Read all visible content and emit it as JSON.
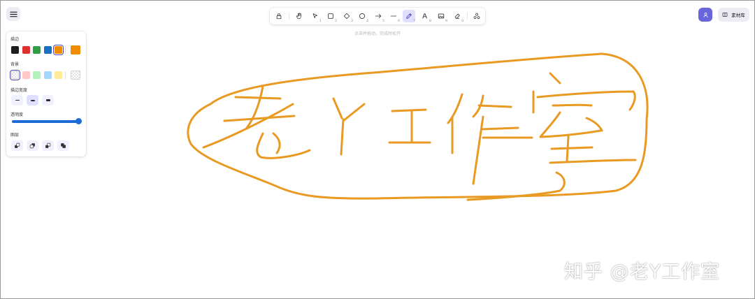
{
  "hint": "点击并拖动，完成时松开",
  "toolbar": {
    "tools": [
      {
        "name": "lock-tool",
        "icon": "lock-icon",
        "key": ""
      },
      {
        "name": "hand-tool",
        "icon": "hand-icon",
        "key": ""
      },
      {
        "name": "select-tool",
        "icon": "pointer-icon",
        "key": "1"
      },
      {
        "name": "rectangle-tool",
        "icon": "square-icon",
        "key": "2"
      },
      {
        "name": "diamond-tool",
        "icon": "diamond-icon",
        "key": "3"
      },
      {
        "name": "ellipse-tool",
        "icon": "circle-icon",
        "key": "4"
      },
      {
        "name": "arrow-tool",
        "icon": "arrow-right-icon",
        "key": "5"
      },
      {
        "name": "line-tool",
        "icon": "line-icon",
        "key": "6"
      },
      {
        "name": "draw-tool",
        "icon": "pencil-icon",
        "key": "7",
        "active": true
      },
      {
        "name": "text-tool",
        "icon": "text-icon",
        "key": "8"
      },
      {
        "name": "image-tool",
        "icon": "image-icon",
        "key": "9"
      },
      {
        "name": "eraser-tool",
        "icon": "eraser-icon",
        "key": "0"
      },
      {
        "name": "more-tools",
        "icon": "shapes-icon",
        "key": ""
      }
    ]
  },
  "library": {
    "label": "素材库"
  },
  "properties": {
    "stroke_label": "描边",
    "stroke_colors": [
      "#1e1e1e",
      "#e03131",
      "#2f9e44",
      "#1971c2",
      "#f08c00"
    ],
    "stroke_selected": "#f08c00",
    "background_label": "背景",
    "background_colors": [
      "transparent",
      "#ffc9c9",
      "#b2f2bb",
      "#a5d8ff",
      "#ffec99"
    ],
    "background_selected": "transparent",
    "stroke_width_label": "描边宽度",
    "opacity_label": "透明度",
    "opacity_value": 1.0,
    "layers_label": "图层"
  },
  "drawing": {
    "stroke_color": "#e89a23",
    "handwritten_text": "老丫工作室"
  },
  "watermark": "知乎 @老Y工作室"
}
